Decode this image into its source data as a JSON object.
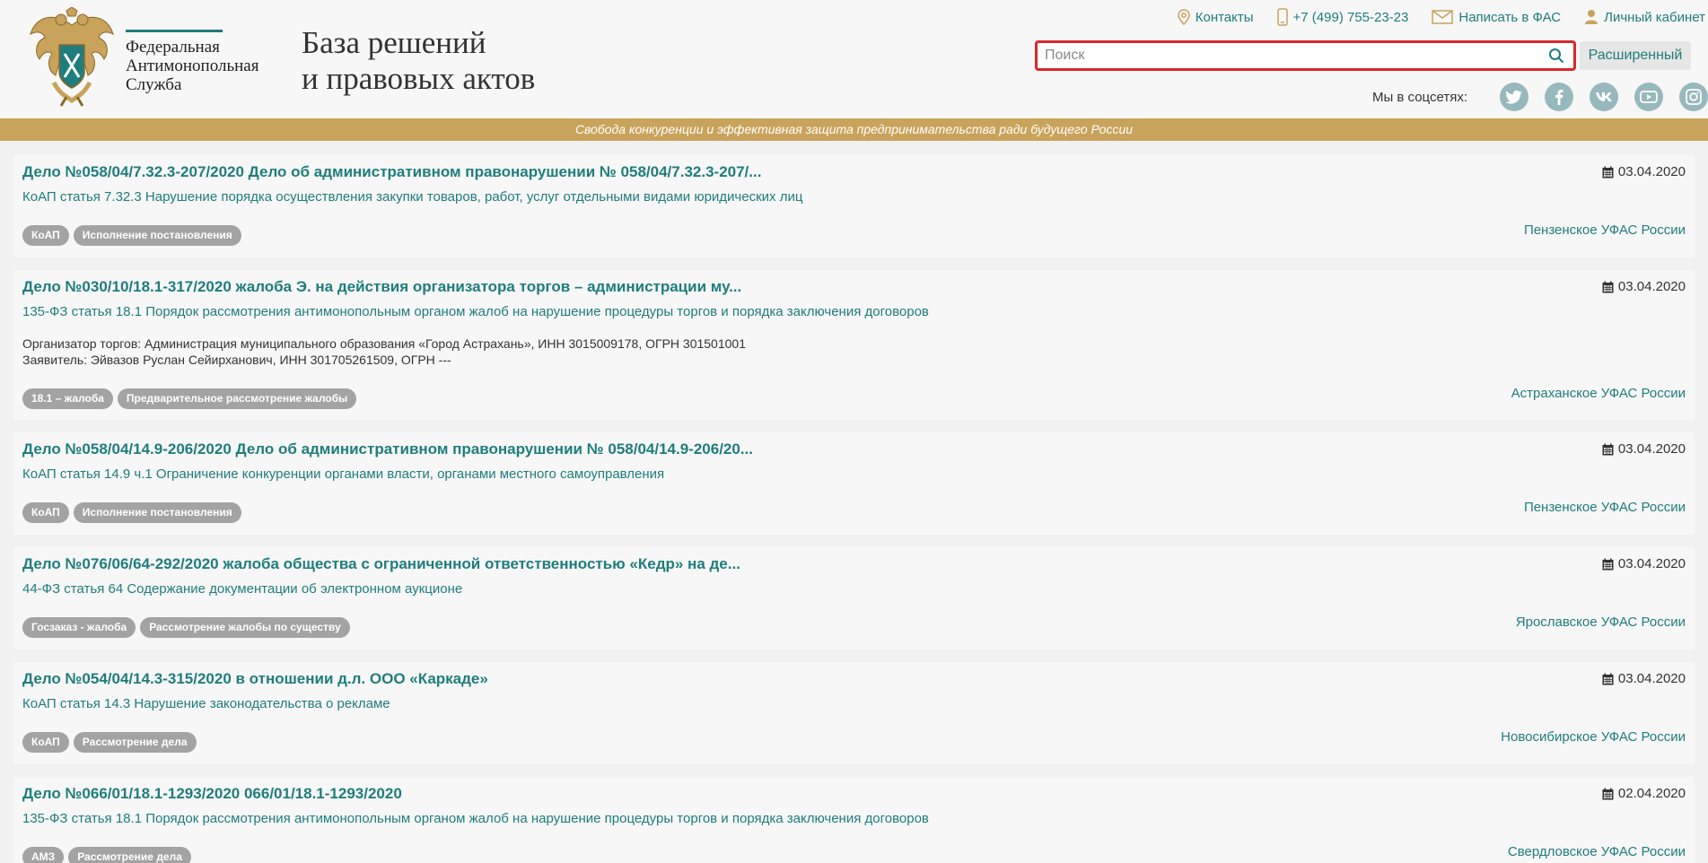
{
  "header": {
    "org_name": [
      "Федеральная",
      "Антимонопольная",
      "Служба"
    ],
    "db_title": [
      "База решений",
      "и правовых актов"
    ],
    "top_links": [
      {
        "label": "Контакты",
        "icon": "location-pin-icon"
      },
      {
        "label": "+7 (499) 755-23-23",
        "icon": "phone-icon"
      },
      {
        "label": "Написать в ФАС",
        "icon": "envelope-icon"
      },
      {
        "label": "Личный кабинет",
        "icon": "user-icon"
      }
    ],
    "search": {
      "placeholder": "Поиск",
      "value": ""
    },
    "advanced_label": "Расширенный",
    "social_label": "Мы в соцсетях:",
    "social": [
      "twitter-icon",
      "facebook-icon",
      "vk-icon",
      "youtube-icon",
      "instagram-icon"
    ],
    "slogan": "Свобода конкуренции и эффективная защита предпринимательства ради будущего России"
  },
  "colors": {
    "accent": "#1f7d7d",
    "slogan_bar": "#c9a35b",
    "search_border": "#d9282a",
    "tag_bg": "#a3a3a3"
  },
  "cards": [
    {
      "title": "Дело №058/04/7.32.3-207/2020 Дело об административном правонарушении № 058/04/7.32.3-207/...",
      "subtitle": "КоАП статья 7.32.3 Нарушение порядка осуществления закупки товаров, работ, услуг отдельными видами юридических лиц",
      "date": "03.04.2020",
      "tags": [
        "КоАП",
        "Исполнение постановления"
      ],
      "region": "Пензенское УФАС России"
    },
    {
      "title": "Дело №030/10/18.1-317/2020 жалоба Э. на действия организатора торгов – администрации му...",
      "subtitle": "135-ФЗ статья 18.1 Порядок рассмотрения антимонопольным органом жалоб на нарушение процедуры торгов и порядка заключения договоров",
      "date": "03.04.2020",
      "info": [
        {
          "label": "Организатор торгов:",
          "value": " Администрация муниципального образования «Город Астрахань», ИНН 3015009178, ОГРН 301501001"
        },
        {
          "label": "Заявитель:",
          "value": " Эйвазов Руслан Сейирханович, ИНН 301705261509, ОГРН ---"
        }
      ],
      "tags": [
        "18.1 – жалоба",
        "Предварительное рассмотрение жалобы"
      ],
      "region": "Астраханское УФАС России"
    },
    {
      "title": "Дело №058/04/14.9-206/2020 Дело об административном правонарушении № 058/04/14.9-206/20...",
      "subtitle": "КоАП статья 14.9 ч.1 Ограничение конкуренции органами власти, органами местного самоуправления",
      "date": "03.04.2020",
      "tags": [
        "КоАП",
        "Исполнение постановления"
      ],
      "region": "Пензенское УФАС России"
    },
    {
      "title": "Дело №076/06/64-292/2020 жалоба общества с ограниченной ответственностью «Кедр» на де...",
      "subtitle": "44-ФЗ статья 64 Содержание документации об электронном аукционе",
      "date": "03.04.2020",
      "tags": [
        "Госзаказ - жалоба",
        "Рассмотрение жалобы по существу"
      ],
      "region": "Ярославское УФАС России"
    },
    {
      "title": "Дело №054/04/14.3-315/2020 в отношении д.л. ООО «Каркаде»",
      "subtitle": "КоАП статья 14.3 Нарушение законодательства о рекламе",
      "date": "03.04.2020",
      "tags": [
        "КоАП",
        "Рассмотрение дела"
      ],
      "region": "Новосибирское УФАС России"
    },
    {
      "title": "Дело №066/01/18.1-1293/2020 066/01/18.1-1293/2020",
      "subtitle": "135-ФЗ статья 18.1 Порядок рассмотрения антимонопольным органом жалоб на нарушение процедуры торгов и порядка заключения договоров",
      "date": "02.04.2020",
      "tags": [
        "АМЗ",
        "Рассмотрение дела"
      ],
      "region": "Свердловское УФАС России"
    }
  ]
}
